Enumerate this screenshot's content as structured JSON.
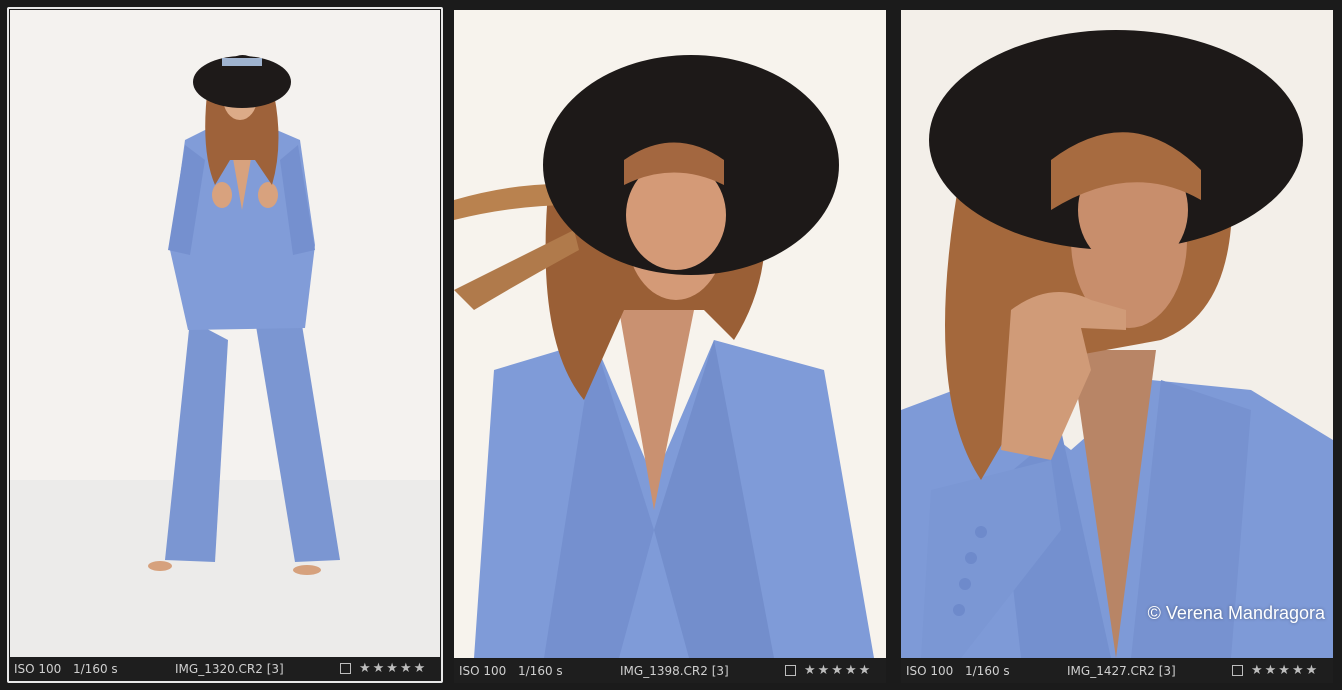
{
  "thumbnails": [
    {
      "selected": true,
      "iso": "ISO 100",
      "shutter": "1/160 s",
      "filename": "IMG_1320.CR2 [3]",
      "stars": "★★★★★"
    },
    {
      "selected": false,
      "iso": "ISO 100",
      "shutter": "1/160 s",
      "filename": "IMG_1398.CR2 [3]",
      "stars": "★★★★★"
    },
    {
      "selected": false,
      "iso": "ISO 100",
      "shutter": "1/160 s",
      "filename": "IMG_1427.CR2 [3]",
      "stars": "★★★★★",
      "watermark": "© Verena Mandragora"
    }
  ],
  "colors": {
    "background": "#1b1b1b",
    "suit": "#7e9ad6",
    "hat": "#1f1a18",
    "hair": "#a9683c",
    "skin": "#d9a47f",
    "studio": "#f6f3ee"
  }
}
